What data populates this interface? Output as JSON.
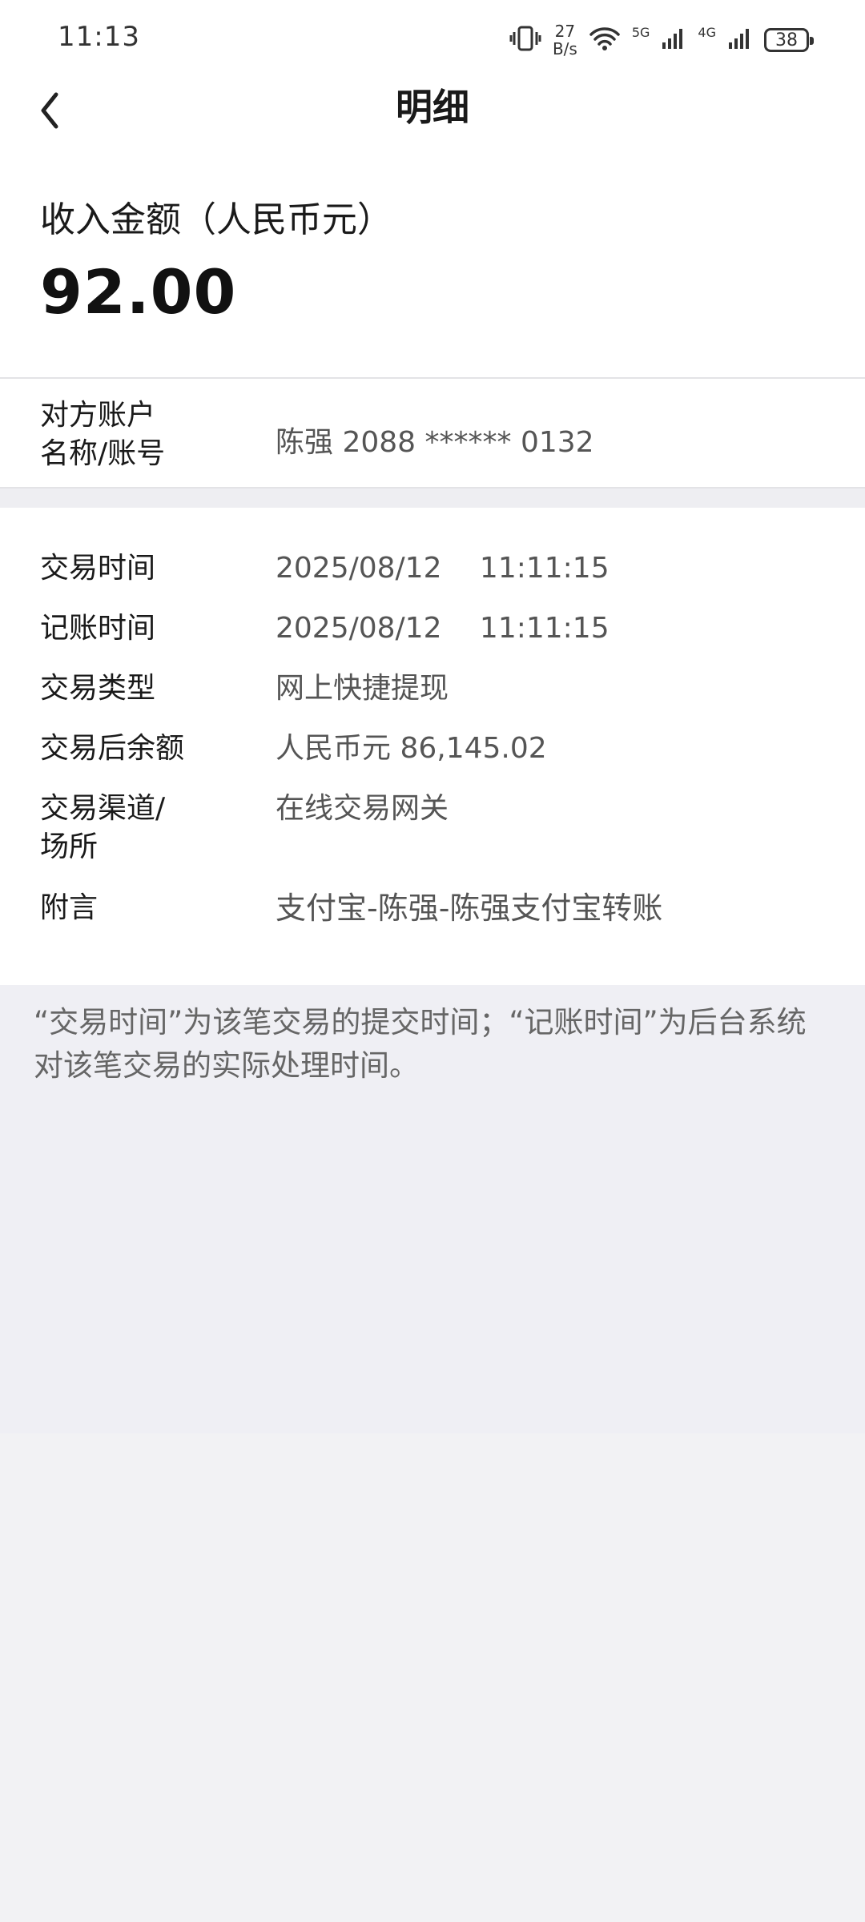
{
  "status_bar": {
    "time": "11:13",
    "speed_value": "27",
    "speed_unit": "B/s",
    "net1": "5G",
    "net2": "4G",
    "battery": "38"
  },
  "header": {
    "title": "明细"
  },
  "summary": {
    "label": "收入金额（人民币元）",
    "amount": "92.00"
  },
  "account": {
    "label_line1": "对方账户",
    "label_line2": "名称/账号",
    "value": "陈强 2088 ****** 0132"
  },
  "details": [
    {
      "label": "交易时间",
      "value": "2025/08/12　 11:11:15"
    },
    {
      "label": "记账时间",
      "value": "2025/08/12　 11:11:15"
    },
    {
      "label": "交易类型",
      "value": "网上快捷提现"
    },
    {
      "label": "交易后余额",
      "value": "人民币元 86,145.02"
    },
    {
      "label": "交易渠道/",
      "label2": "场所",
      "value": "在线交易网关"
    },
    {
      "label": "附言",
      "value": "支付宝-陈强-陈强支付宝转账"
    }
  ],
  "note": "“交易时间”为该笔交易的提交时间；“记账时间”为后台系统对该笔交易的实际处理时间。"
}
